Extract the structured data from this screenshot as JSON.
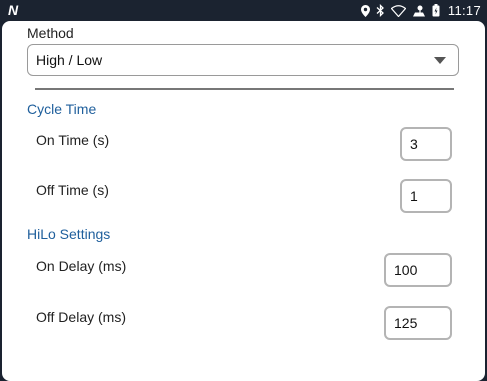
{
  "status_bar": {
    "logo": "N",
    "time": "11:17",
    "icons": [
      "location-icon",
      "bluetooth-icon",
      "wifi-icon",
      "hotspot-icon",
      "battery-icon"
    ]
  },
  "form": {
    "method": {
      "label": "Method",
      "selected": "High / Low"
    },
    "cycle_time": {
      "title": "Cycle Time",
      "on_time": {
        "label": "On Time (s)",
        "value": "3"
      },
      "off_time": {
        "label": "Off Time (s)",
        "value": "1"
      }
    },
    "hilo_settings": {
      "title": "HiLo Settings",
      "on_delay": {
        "label": "On Delay (ms)",
        "value": "100"
      },
      "off_delay": {
        "label": "Off Delay (ms)",
        "value": "125"
      }
    }
  },
  "colors": {
    "section_title": "#1f5f9c",
    "status_bar": "#1b2330"
  }
}
